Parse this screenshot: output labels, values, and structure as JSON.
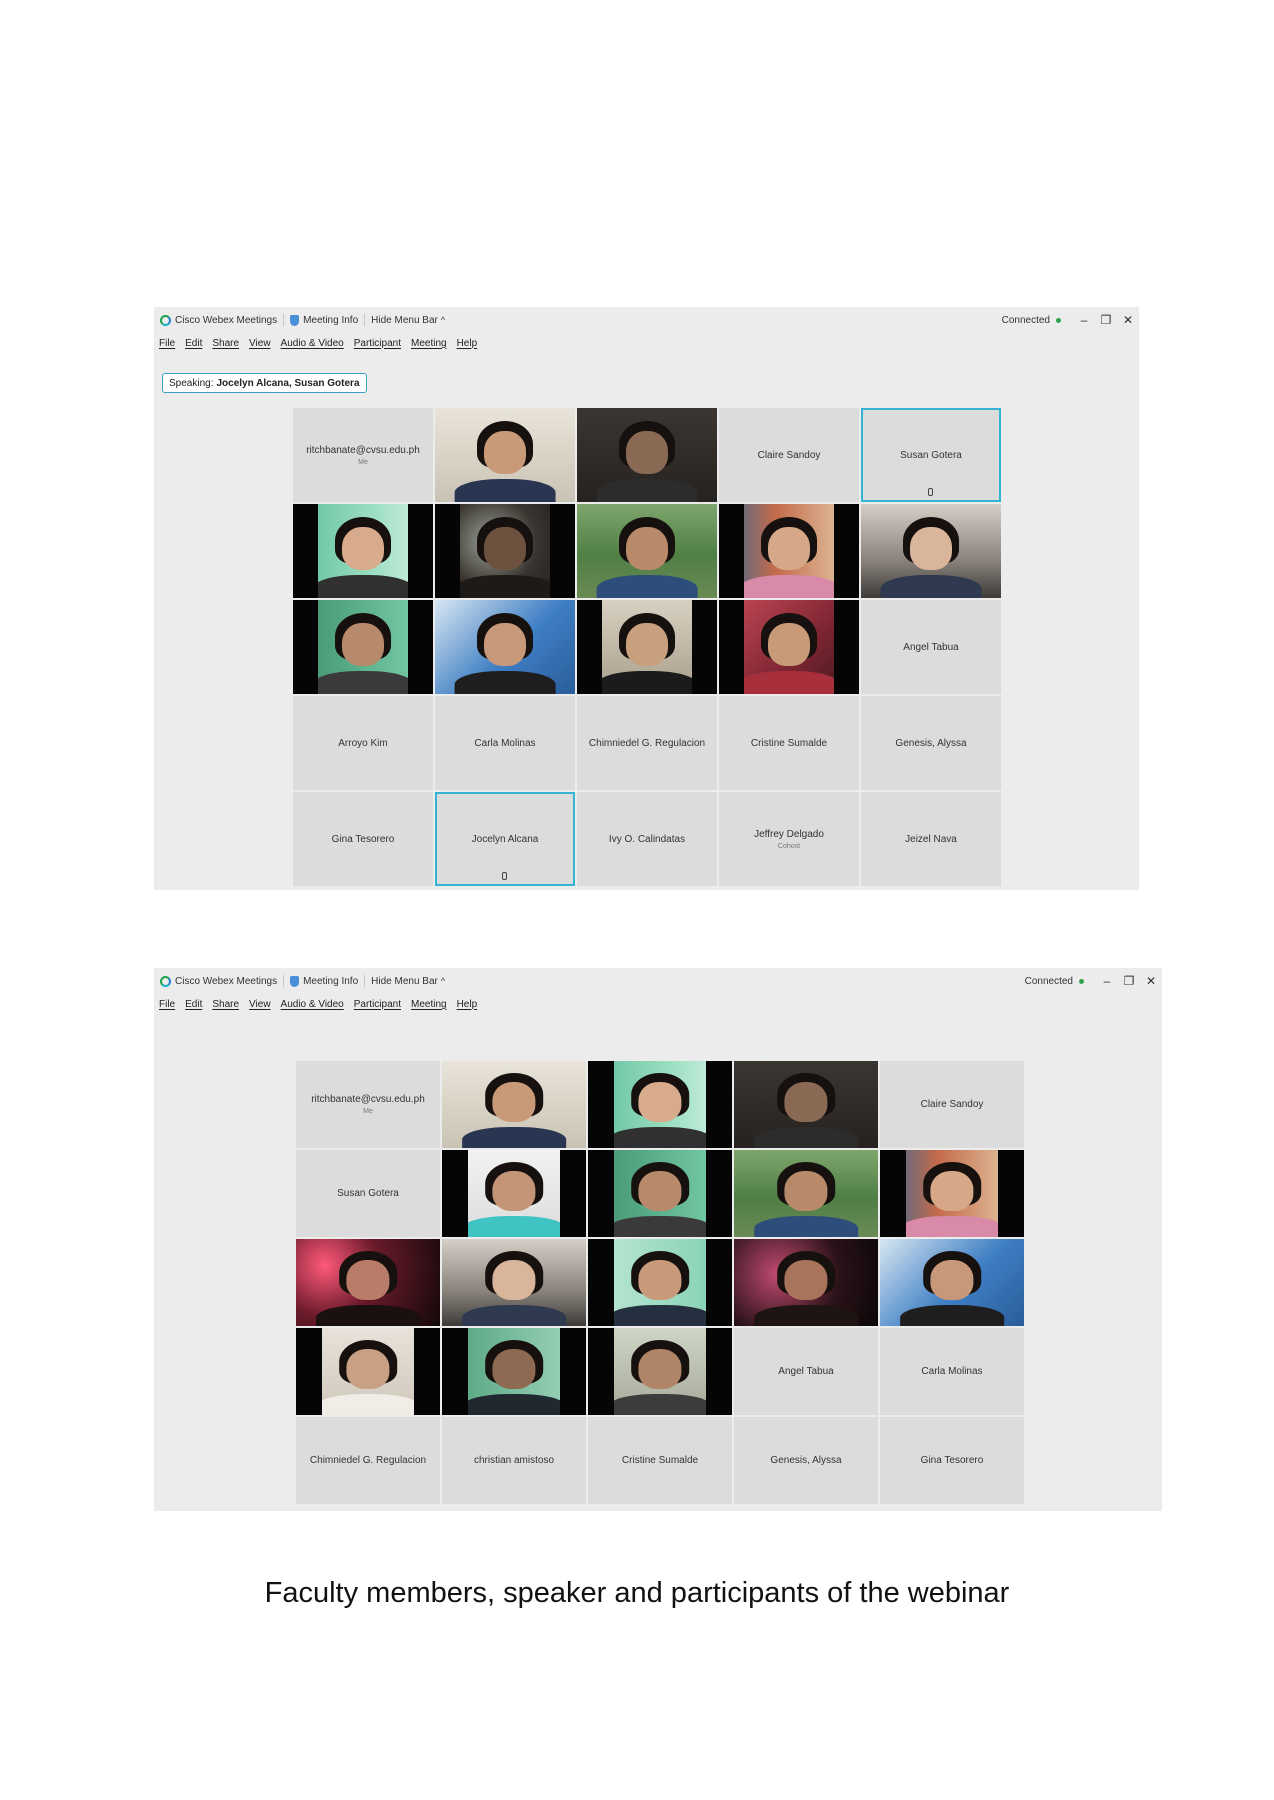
{
  "app_title": "Cisco Webex Meetings",
  "meeting_info_label": "Meeting Info",
  "hide_menu_label": "Hide Menu Bar",
  "connection_status": "Connected",
  "menu": [
    "File",
    "Edit",
    "Share",
    "View",
    "Audio & Video",
    "Participant",
    "Meeting",
    "Help"
  ],
  "speaking": {
    "label": "Speaking:",
    "names": "Jocelyn Alcana, Susan Gotera"
  },
  "screenshot1_tiles": [
    {
      "type": "name",
      "label": "ritchbanate@cvsu.edu.ph",
      "sub": "Me"
    },
    {
      "type": "video",
      "scene": "bright-room"
    },
    {
      "type": "video",
      "scene": "dark-room"
    },
    {
      "type": "name",
      "label": "Claire Sandoy"
    },
    {
      "type": "name",
      "label": "Susan Gotera",
      "active": true,
      "mic": true
    },
    {
      "type": "video",
      "scene": "green-wall"
    },
    {
      "type": "video",
      "scene": "dim-window"
    },
    {
      "type": "video",
      "scene": "trees"
    },
    {
      "type": "video",
      "scene": "colorful-room"
    },
    {
      "type": "video",
      "scene": "room-chevron"
    },
    {
      "type": "video",
      "scene": "green-wall-2"
    },
    {
      "type": "video",
      "scene": "blue-pillow"
    },
    {
      "type": "video",
      "scene": "masked"
    },
    {
      "type": "video",
      "scene": "red-blanket"
    },
    {
      "type": "name",
      "label": "Angel Tabua"
    },
    {
      "type": "name",
      "label": "Arroyo Kim"
    },
    {
      "type": "name",
      "label": "Carla Molinas"
    },
    {
      "type": "name",
      "label": "Chimniedel G. Regulacion"
    },
    {
      "type": "name",
      "label": "Cristine Sumalde"
    },
    {
      "type": "name",
      "label": "Genesis, Alyssa"
    },
    {
      "type": "name",
      "label": "Gina Tesorero"
    },
    {
      "type": "name",
      "label": "Jocelyn Alcana",
      "active": true,
      "mic": true
    },
    {
      "type": "name",
      "label": "Ivy O. Calindatas"
    },
    {
      "type": "name",
      "label": "Jeffrey Delgado",
      "sub": "Cohost"
    },
    {
      "type": "name",
      "label": "Jeizel Nava"
    }
  ],
  "screenshot2_tiles": [
    {
      "type": "name",
      "label": "ritchbanate@cvsu.edu.ph",
      "sub": "Me"
    },
    {
      "type": "video",
      "scene": "bright-room"
    },
    {
      "type": "video",
      "scene": "green-wall"
    },
    {
      "type": "video",
      "scene": "dark-room"
    },
    {
      "type": "name",
      "label": "Claire Sandoy"
    },
    {
      "type": "name",
      "label": "Susan Gotera"
    },
    {
      "type": "video",
      "scene": "teal-shirt"
    },
    {
      "type": "video",
      "scene": "green-wall-2"
    },
    {
      "type": "video",
      "scene": "trees"
    },
    {
      "type": "video",
      "scene": "colorful-room"
    },
    {
      "type": "video",
      "scene": "red-light"
    },
    {
      "type": "video",
      "scene": "room-chevron"
    },
    {
      "type": "video",
      "scene": "mint-smile"
    },
    {
      "type": "video",
      "scene": "dark-pink"
    },
    {
      "type": "video",
      "scene": "blue-pillow"
    },
    {
      "type": "video",
      "scene": "bed-pillow"
    },
    {
      "type": "video",
      "scene": "green-room"
    },
    {
      "type": "video",
      "scene": "outdoor-wall"
    },
    {
      "type": "name",
      "label": "Angel Tabua"
    },
    {
      "type": "name",
      "label": "Carla Molinas"
    },
    {
      "type": "name",
      "label": "Chimniedel G. Regulacion"
    },
    {
      "type": "name",
      "label": "christian amistoso"
    },
    {
      "type": "name",
      "label": "Cristine Sumalde"
    },
    {
      "type": "name",
      "label": "Genesis, Alyssa"
    },
    {
      "type": "name",
      "label": "Gina Tesorero"
    }
  ],
  "caption": "Faculty members, speaker and participants of the webinar"
}
